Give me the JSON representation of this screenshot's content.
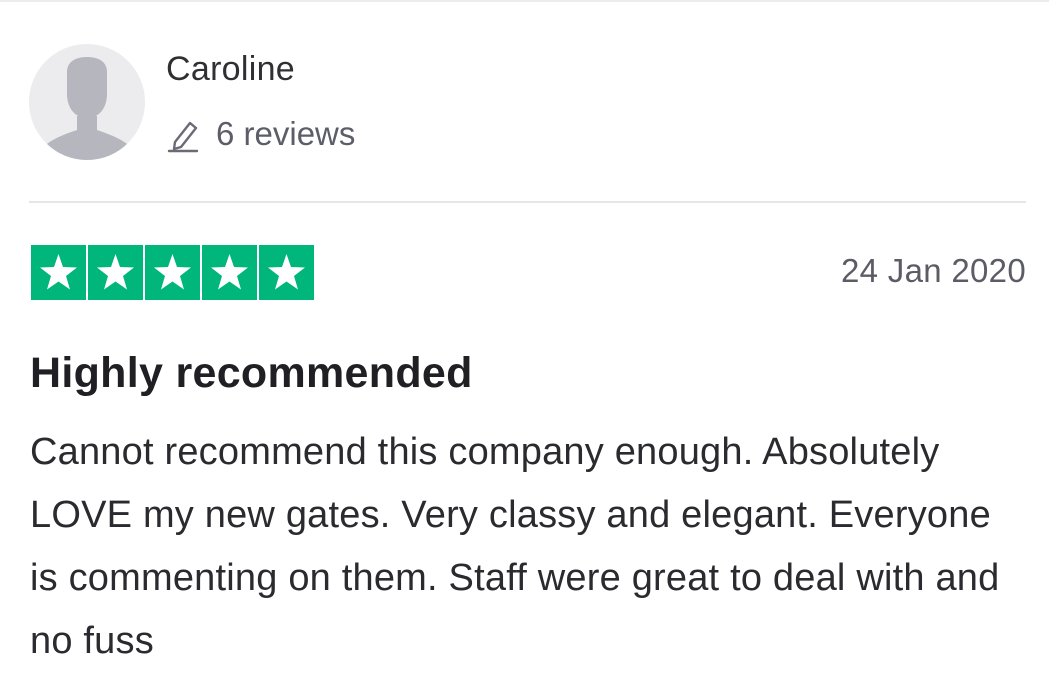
{
  "reviewer": {
    "name": "Caroline",
    "review_count": "6 reviews",
    "avatar_icon": "user-silhouette-icon",
    "count_icon": "pencil-icon"
  },
  "review": {
    "rating": 5,
    "rating_max": 5,
    "star_color": "#00b67a",
    "date": "24 Jan 2020",
    "title": "Highly recommended",
    "body": "Cannot recommend this company enough. Absolutely LOVE my new gates. Very classy and elegant. Everyone is commenting on them. Staff were great to deal with and no fuss"
  }
}
